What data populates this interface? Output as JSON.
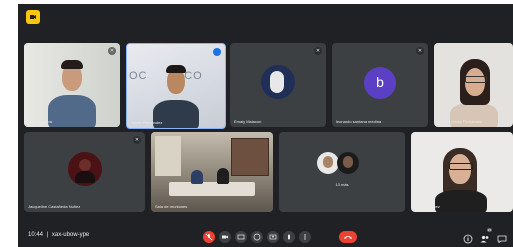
{
  "meeting": {
    "time": "10:44",
    "code": "xax-ubow-ype",
    "separator": "|"
  },
  "participants": [
    {
      "name": "Tom Noguera",
      "kind": "video"
    },
    {
      "name": "Javier Hernandez",
      "kind": "video"
    },
    {
      "name": "Emaly Malacon",
      "kind": "avatar"
    },
    {
      "name": "leonardo santana medina",
      "kind": "letter",
      "letter": "b"
    },
    {
      "name": "Beatriz Hevia Fernandez",
      "kind": "video"
    },
    {
      "name": "Jacqueline Castañeda Nuñez",
      "kind": "avatar"
    },
    {
      "name": "Sala de reuniones",
      "kind": "video"
    },
    {
      "name": "13 más",
      "kind": "group"
    },
    {
      "name": "Sandra López",
      "kind": "video"
    }
  ],
  "toolbar": {
    "participant_count": "25",
    "icons": [
      "mic-off-icon",
      "camera-icon",
      "captions-icon",
      "emoji-icon",
      "present-icon",
      "raise-hand-icon",
      "more-icon",
      "end-call-icon",
      "info-icon",
      "people-icon",
      "chat-icon"
    ]
  },
  "colors": {
    "background": "#202124",
    "tile": "#3c4043",
    "accent_red": "#ea4335",
    "letter_avatar": "#5b3fc4",
    "logo_yellow": "#f9c80e"
  }
}
